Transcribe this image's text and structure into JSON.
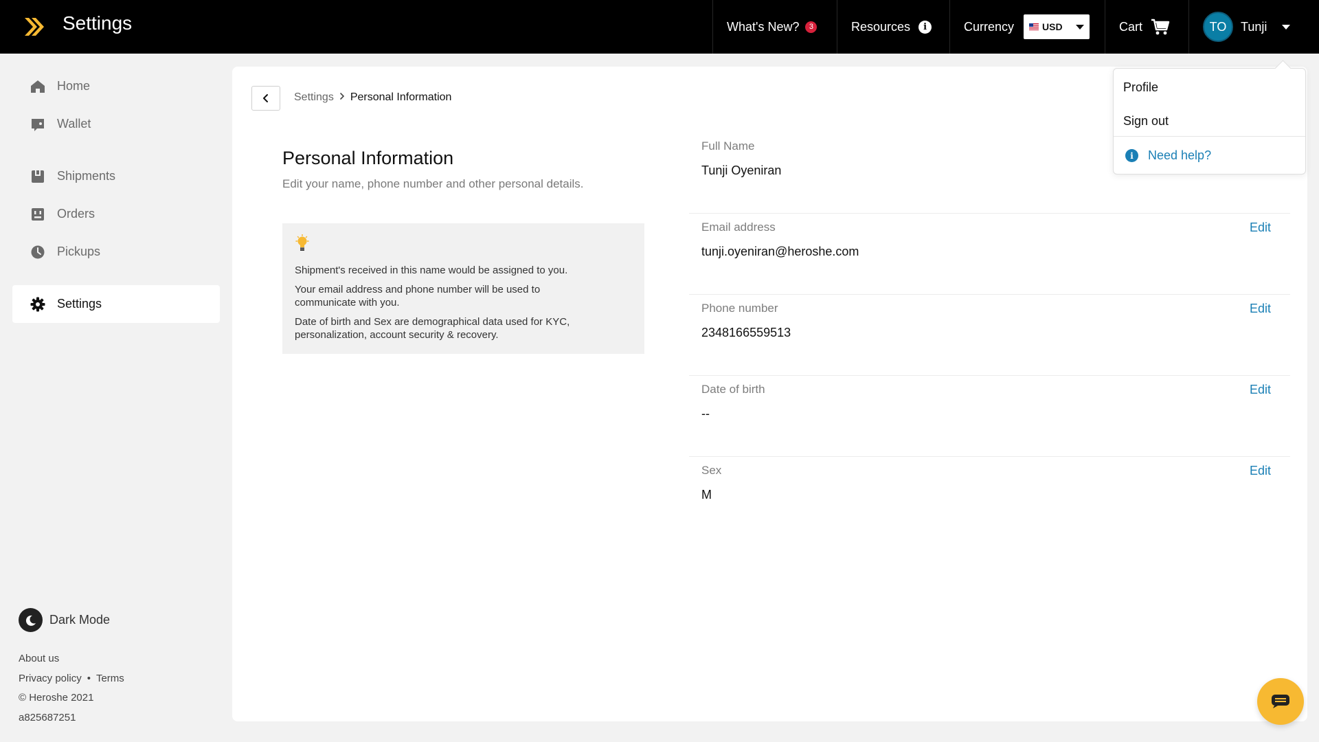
{
  "app": {
    "title": "Settings"
  },
  "topbar": {
    "whats_new": {
      "label": "What's New?",
      "badge": "3"
    },
    "resources": {
      "label": "Resources",
      "info_glyph": "i"
    },
    "currency": {
      "label": "Currency",
      "selected": "USD"
    },
    "cart": {
      "label": "Cart"
    },
    "user": {
      "initials": "TO",
      "name": "Tunji"
    }
  },
  "sidebar": {
    "items": [
      {
        "label": "Home",
        "icon": "home-icon"
      },
      {
        "label": "Wallet",
        "icon": "wallet-icon"
      },
      {
        "label": "Shipments",
        "icon": "shipments-icon"
      },
      {
        "label": "Orders",
        "icon": "orders-icon"
      },
      {
        "label": "Pickups",
        "icon": "pickups-icon"
      },
      {
        "label": "Settings",
        "icon": "gear-icon",
        "active": true
      }
    ],
    "dark_mode_label": "Dark Mode",
    "footer": {
      "about": "About us",
      "privacy": "Privacy policy",
      "separator": "•",
      "terms": "Terms",
      "copyright": "© Heroshe 2021",
      "build": "a825687251"
    }
  },
  "breadcrumb": {
    "parent": "Settings",
    "current": "Personal Information"
  },
  "page": {
    "title": "Personal Information",
    "subtitle": "Edit your name, phone number and other personal details."
  },
  "tip": {
    "lines": [
      "Shipment's received in this name would be assigned to you.",
      "Your email address and phone number will be used to communicate with you.",
      "Date of birth and Sex are demographical data used for KYC, personalization, account security & recovery."
    ]
  },
  "fields": [
    {
      "label": "Full Name",
      "value": "Tunji Oyeniran",
      "editable": false
    },
    {
      "label": "Email address",
      "value": "tunji.oyeniran@heroshe.com",
      "editable": true
    },
    {
      "label": "Phone number",
      "value": "2348166559513",
      "editable": true
    },
    {
      "label": "Date of birth",
      "value": "--",
      "editable": true
    },
    {
      "label": "Sex",
      "value": "M",
      "editable": true
    }
  ],
  "edit_label": "Edit",
  "dropdown": {
    "profile": "Profile",
    "sign_out": "Sign out",
    "need_help": "Need help?"
  },
  "colors": {
    "accent": "#1a7fb5",
    "brand_yellow": "#f7b932",
    "topbar": "#000000",
    "badge": "#d6213b"
  }
}
